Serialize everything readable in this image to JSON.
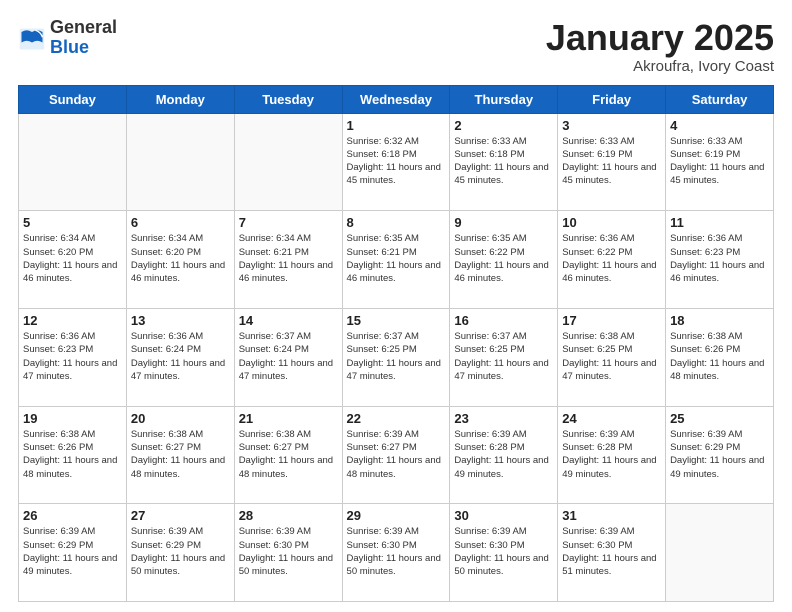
{
  "header": {
    "logo_general": "General",
    "logo_blue": "Blue",
    "month_title": "January 2025",
    "location": "Akroufra, Ivory Coast"
  },
  "weekdays": [
    "Sunday",
    "Monday",
    "Tuesday",
    "Wednesday",
    "Thursday",
    "Friday",
    "Saturday"
  ],
  "weeks": [
    [
      {
        "day": "",
        "info": ""
      },
      {
        "day": "",
        "info": ""
      },
      {
        "day": "",
        "info": ""
      },
      {
        "day": "1",
        "info": "Sunrise: 6:32 AM\nSunset: 6:18 PM\nDaylight: 11 hours and 45 minutes."
      },
      {
        "day": "2",
        "info": "Sunrise: 6:33 AM\nSunset: 6:18 PM\nDaylight: 11 hours and 45 minutes."
      },
      {
        "day": "3",
        "info": "Sunrise: 6:33 AM\nSunset: 6:19 PM\nDaylight: 11 hours and 45 minutes."
      },
      {
        "day": "4",
        "info": "Sunrise: 6:33 AM\nSunset: 6:19 PM\nDaylight: 11 hours and 45 minutes."
      }
    ],
    [
      {
        "day": "5",
        "info": "Sunrise: 6:34 AM\nSunset: 6:20 PM\nDaylight: 11 hours and 46 minutes."
      },
      {
        "day": "6",
        "info": "Sunrise: 6:34 AM\nSunset: 6:20 PM\nDaylight: 11 hours and 46 minutes."
      },
      {
        "day": "7",
        "info": "Sunrise: 6:34 AM\nSunset: 6:21 PM\nDaylight: 11 hours and 46 minutes."
      },
      {
        "day": "8",
        "info": "Sunrise: 6:35 AM\nSunset: 6:21 PM\nDaylight: 11 hours and 46 minutes."
      },
      {
        "day": "9",
        "info": "Sunrise: 6:35 AM\nSunset: 6:22 PM\nDaylight: 11 hours and 46 minutes."
      },
      {
        "day": "10",
        "info": "Sunrise: 6:36 AM\nSunset: 6:22 PM\nDaylight: 11 hours and 46 minutes."
      },
      {
        "day": "11",
        "info": "Sunrise: 6:36 AM\nSunset: 6:23 PM\nDaylight: 11 hours and 46 minutes."
      }
    ],
    [
      {
        "day": "12",
        "info": "Sunrise: 6:36 AM\nSunset: 6:23 PM\nDaylight: 11 hours and 47 minutes."
      },
      {
        "day": "13",
        "info": "Sunrise: 6:36 AM\nSunset: 6:24 PM\nDaylight: 11 hours and 47 minutes."
      },
      {
        "day": "14",
        "info": "Sunrise: 6:37 AM\nSunset: 6:24 PM\nDaylight: 11 hours and 47 minutes."
      },
      {
        "day": "15",
        "info": "Sunrise: 6:37 AM\nSunset: 6:25 PM\nDaylight: 11 hours and 47 minutes."
      },
      {
        "day": "16",
        "info": "Sunrise: 6:37 AM\nSunset: 6:25 PM\nDaylight: 11 hours and 47 minutes."
      },
      {
        "day": "17",
        "info": "Sunrise: 6:38 AM\nSunset: 6:25 PM\nDaylight: 11 hours and 47 minutes."
      },
      {
        "day": "18",
        "info": "Sunrise: 6:38 AM\nSunset: 6:26 PM\nDaylight: 11 hours and 48 minutes."
      }
    ],
    [
      {
        "day": "19",
        "info": "Sunrise: 6:38 AM\nSunset: 6:26 PM\nDaylight: 11 hours and 48 minutes."
      },
      {
        "day": "20",
        "info": "Sunrise: 6:38 AM\nSunset: 6:27 PM\nDaylight: 11 hours and 48 minutes."
      },
      {
        "day": "21",
        "info": "Sunrise: 6:38 AM\nSunset: 6:27 PM\nDaylight: 11 hours and 48 minutes."
      },
      {
        "day": "22",
        "info": "Sunrise: 6:39 AM\nSunset: 6:27 PM\nDaylight: 11 hours and 48 minutes."
      },
      {
        "day": "23",
        "info": "Sunrise: 6:39 AM\nSunset: 6:28 PM\nDaylight: 11 hours and 49 minutes."
      },
      {
        "day": "24",
        "info": "Sunrise: 6:39 AM\nSunset: 6:28 PM\nDaylight: 11 hours and 49 minutes."
      },
      {
        "day": "25",
        "info": "Sunrise: 6:39 AM\nSunset: 6:29 PM\nDaylight: 11 hours and 49 minutes."
      }
    ],
    [
      {
        "day": "26",
        "info": "Sunrise: 6:39 AM\nSunset: 6:29 PM\nDaylight: 11 hours and 49 minutes."
      },
      {
        "day": "27",
        "info": "Sunrise: 6:39 AM\nSunset: 6:29 PM\nDaylight: 11 hours and 50 minutes."
      },
      {
        "day": "28",
        "info": "Sunrise: 6:39 AM\nSunset: 6:30 PM\nDaylight: 11 hours and 50 minutes."
      },
      {
        "day": "29",
        "info": "Sunrise: 6:39 AM\nSunset: 6:30 PM\nDaylight: 11 hours and 50 minutes."
      },
      {
        "day": "30",
        "info": "Sunrise: 6:39 AM\nSunset: 6:30 PM\nDaylight: 11 hours and 50 minutes."
      },
      {
        "day": "31",
        "info": "Sunrise: 6:39 AM\nSunset: 6:30 PM\nDaylight: 11 hours and 51 minutes."
      },
      {
        "day": "",
        "info": ""
      }
    ]
  ]
}
